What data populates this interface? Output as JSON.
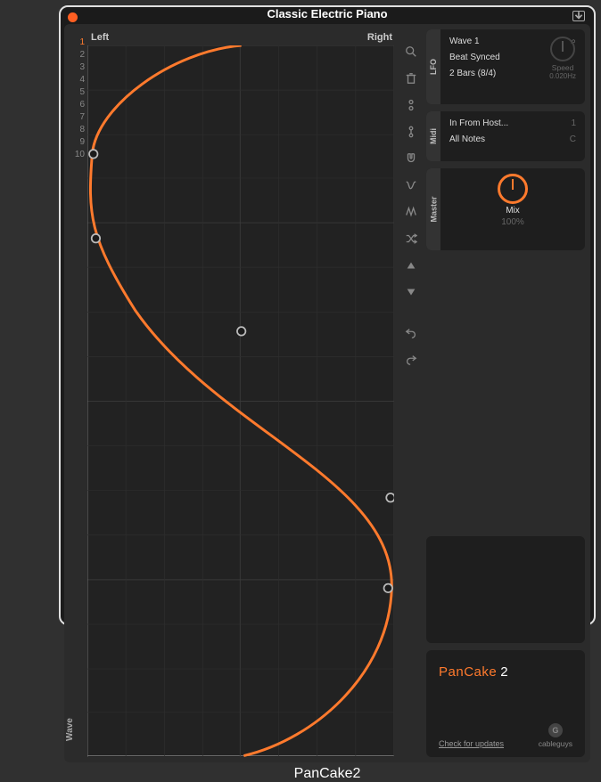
{
  "window": {
    "title": "Classic Electric Piano",
    "footer": "PanCake2"
  },
  "wave": {
    "left_label": "Left",
    "right_label": "Right",
    "axis_label": "Wave",
    "slots": [
      "1",
      "2",
      "3",
      "4",
      "5",
      "6",
      "7",
      "8",
      "9",
      "10"
    ],
    "active_slot": 0
  },
  "lfo": {
    "tab": "LFO",
    "wave_name": "Wave 1",
    "sync_mode": "Beat Synced",
    "rate": "2 Bars (8/4)",
    "speed_label": "Speed",
    "speed_value": "0.020Hz"
  },
  "midi": {
    "tab": "Midi",
    "input": "In From Host...",
    "input_hint": "1",
    "notes": "All Notes",
    "notes_hint": "C"
  },
  "master": {
    "tab": "Master",
    "mix_label": "Mix",
    "mix_value": "100%"
  },
  "brand": {
    "name_a": "PanCake",
    "name_b": "2",
    "update_link": "Check for updates",
    "company": "cableguys",
    "company_initial": "G"
  },
  "colors": {
    "accent": "#ff7a2d"
  }
}
